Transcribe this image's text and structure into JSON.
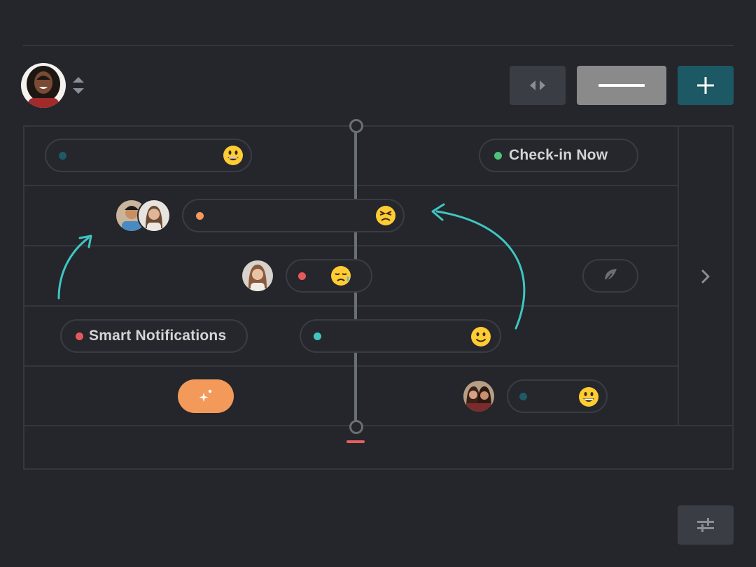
{
  "header": {
    "avatar_icon": "user-avatar",
    "sort_icon": "sort-arrows-icon",
    "buttons": [
      {
        "icon": "code-arrows-icon"
      },
      {
        "icon": "minus-icon"
      },
      {
        "icon": "plus-icon"
      }
    ]
  },
  "rows": {
    "check_in": {
      "label": "Check-in Now",
      "dot_color": "#4cc27a"
    },
    "smart_notifications": {
      "label": "Smart Notifications",
      "dot_color": "#e8585a"
    }
  },
  "status_pills": [
    {
      "dot_color": "#1e5b66",
      "emoji": "grinning-face"
    },
    {
      "dot_color": "#f39a5b",
      "emoji": "persevering-face"
    },
    {
      "dot_color": "#e8585a",
      "emoji": "sad-sweat-face"
    },
    {
      "dot_color": "#3fc6c2",
      "emoji": "slightly-smiling-face"
    },
    {
      "dot_color": "#1e5b66",
      "emoji": "grinning-face"
    }
  ],
  "colors": {
    "background": "#24262b",
    "accent_teal": "#1c5964",
    "arrow_cyan": "#3fc6c2",
    "orange": "#f39a5b",
    "timeline_marker": "#e4605e"
  },
  "icons": {
    "sparkle": "sparkle-icon",
    "leaf": "leaf-icon",
    "next": "chevron-right-icon",
    "settings": "sliders-icon"
  }
}
